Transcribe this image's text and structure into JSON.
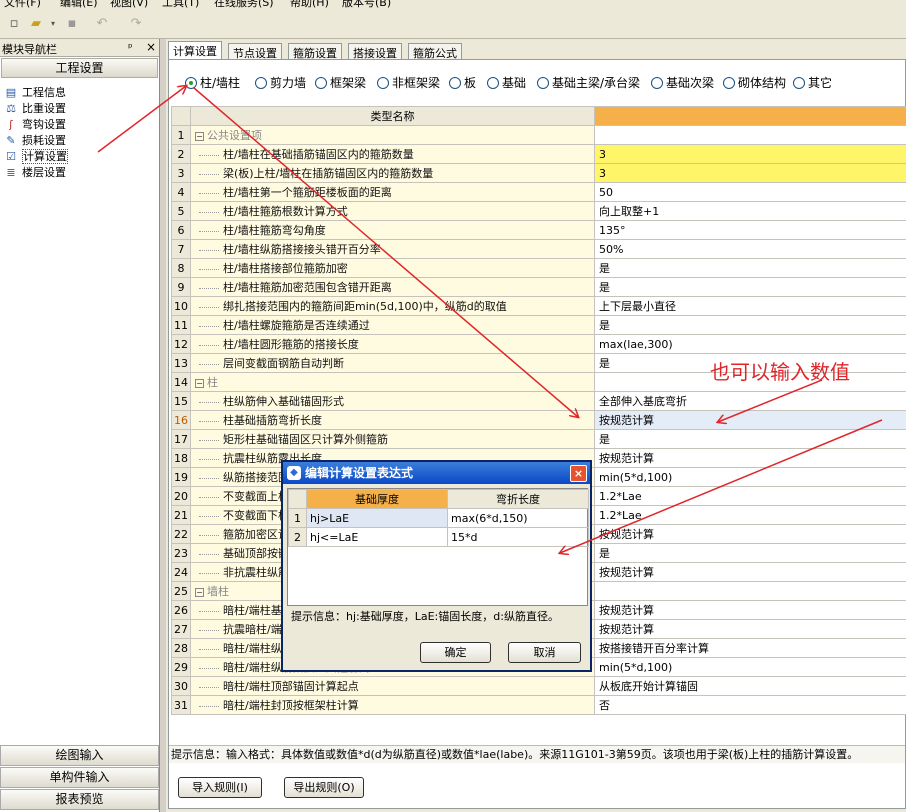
{
  "menubar": {
    "items": [
      "文件(F)",
      "编辑(E)",
      "视图(V)",
      "工具(T)",
      "在线服务(S)",
      "帮助(H)",
      "版本号(B)"
    ]
  },
  "toolbar": {
    "icons": [
      "new-file-icon",
      "open-folder-icon",
      "dropdown-arrow-icon",
      "save-icon",
      "undo-icon",
      "redo-icon"
    ]
  },
  "nav": {
    "header": "模块导航栏",
    "pin": "ᵖ",
    "close": "×",
    "title": "工程设置",
    "items": [
      {
        "label": "工程信息",
        "icon": "project-info-icon"
      },
      {
        "label": "比重设置",
        "icon": "weight-ratio-icon"
      },
      {
        "label": "弯钩设置",
        "icon": "hook-icon"
      },
      {
        "label": "损耗设置",
        "icon": "loss-icon"
      },
      {
        "label": "计算设置",
        "icon": "calc-settings-icon"
      },
      {
        "label": "楼层设置",
        "icon": "floor-icon"
      }
    ],
    "bottom_buttons": [
      "绘图输入",
      "单构件输入",
      "报表预览"
    ]
  },
  "tabs": [
    "计算设置",
    "节点设置",
    "箍筋设置",
    "搭接设置",
    "箍筋公式"
  ],
  "radios": [
    "柱/墙柱",
    "剪力墙",
    "框架梁",
    "非框架梁",
    "板",
    "基础",
    "基础主梁/承台梁",
    "基础次梁",
    "砌体结构",
    "其它"
  ],
  "grid": {
    "headers": [
      "类型名称",
      ""
    ],
    "rows": [
      {
        "n": "1",
        "name": "公共设置项",
        "val": "",
        "group": true
      },
      {
        "n": "2",
        "name": "柱/墙柱在基础插筋锚固区内的箍筋数量",
        "val": "3",
        "yellow": true
      },
      {
        "n": "3",
        "name": "梁(板)上柱/墙柱在插筋锚固区内的箍筋数量",
        "val": "3",
        "yellow": true
      },
      {
        "n": "4",
        "name": "柱/墙柱第一个箍筋距楼板面的距离",
        "val": "50"
      },
      {
        "n": "5",
        "name": "柱/墙柱箍筋根数计算方式",
        "val": "向上取整+1"
      },
      {
        "n": "6",
        "name": "柱/墙柱箍筋弯勾角度",
        "val": "135°"
      },
      {
        "n": "7",
        "name": "柱/墙柱纵筋搭接接头错开百分率",
        "val": "50%"
      },
      {
        "n": "8",
        "name": "柱/墙柱搭接部位箍筋加密",
        "val": "是"
      },
      {
        "n": "9",
        "name": "柱/墙柱箍筋加密范围包含错开距离",
        "val": "是"
      },
      {
        "n": "10",
        "name": "绑扎搭接范围内的箍筋间距min(5d,100)中，纵筋d的取值",
        "val": "上下层最小直径"
      },
      {
        "n": "11",
        "name": "柱/墙柱螺旋箍筋是否连续通过",
        "val": "是"
      },
      {
        "n": "12",
        "name": "柱/墙柱圆形箍筋的搭接长度",
        "val": "max(lae,300)"
      },
      {
        "n": "13",
        "name": "层间变截面钢筋自动判断",
        "val": "是"
      },
      {
        "n": "14",
        "name": "柱",
        "val": "",
        "group": true
      },
      {
        "n": "15",
        "name": "柱纵筋伸入基础锚固形式",
        "val": "全部伸入基底弯折"
      },
      {
        "n": "16",
        "name": "柱基础插筋弯折长度",
        "val": "按规范计算",
        "current": true
      },
      {
        "n": "17",
        "name": "矩形柱基础锚固区只计算外侧箍筋",
        "val": "是"
      },
      {
        "n": "18",
        "name": "抗震柱纵筋露出长度",
        "val": "按规范计算"
      },
      {
        "n": "19",
        "name": "纵筋搭接范围箍筋间距",
        "val": "min(5*d,100)"
      },
      {
        "n": "20",
        "name": "不变截面上柱多出的钢筋锚固",
        "val": "1.2*Lae"
      },
      {
        "n": "21",
        "name": "不变截面下柱多出的钢筋锚固",
        "val": "1.2*Lae"
      },
      {
        "n": "22",
        "name": "箍筋加密区设置",
        "val": "按规范计算"
      },
      {
        "n": "23",
        "name": "基础顶部按嵌固部位处理",
        "val": "是"
      },
      {
        "n": "24",
        "name": "非抗震柱纵筋露出长度",
        "val": "按规范计算"
      },
      {
        "n": "25",
        "name": "墙柱",
        "val": "",
        "group": true
      },
      {
        "n": "26",
        "name": "暗柱/端柱基础插筋弯折长度",
        "val": "按规范计算"
      },
      {
        "n": "27",
        "name": "抗震暗柱/端柱纵筋露出长度",
        "val": "按规范计算"
      },
      {
        "n": "28",
        "name": "暗柱/端柱纵筋搭接接头错开",
        "val": "按搭接错开百分率计算"
      },
      {
        "n": "29",
        "name": "暗柱/端柱纵筋搭接范围箍筋间距",
        "val": "min(5*d,100)"
      },
      {
        "n": "30",
        "name": "暗柱/端柱顶部锚固计算起点",
        "val": "从板底开始计算锚固"
      },
      {
        "n": "31",
        "name": "暗柱/端柱封顶按框架柱计算",
        "val": "否"
      }
    ]
  },
  "hint": "提示信息：输入格式：具体数值或数值*d(d为纵筋直径)或数值*lae(labe)。来源11G101-3第59页。该项也用于梁(板)上柱的插筋计算设置。",
  "bottom_buttons": [
    "导入规则(I)",
    "导出规则(O)"
  ],
  "dialog": {
    "title": "编辑计算设置表达式",
    "close": "×",
    "headers": [
      "基础厚度",
      "弯折长度"
    ],
    "rows": [
      {
        "n": "1",
        "c1": "hj>LaE",
        "c2": "max(6*d,150)"
      },
      {
        "n": "2",
        "c1": "hj<=LaE",
        "c2": "15*d"
      }
    ],
    "hint": "提示信息：hj:基础厚度，LaE:锚固长度，d:纵筋直径。",
    "ok": "确定",
    "cancel": "取消"
  },
  "annotation": "也可以输入数值",
  "colors": {
    "annotation_red": "#e0262a",
    "header_orange": "#f5b04a",
    "value_yellow": "#fff568"
  }
}
